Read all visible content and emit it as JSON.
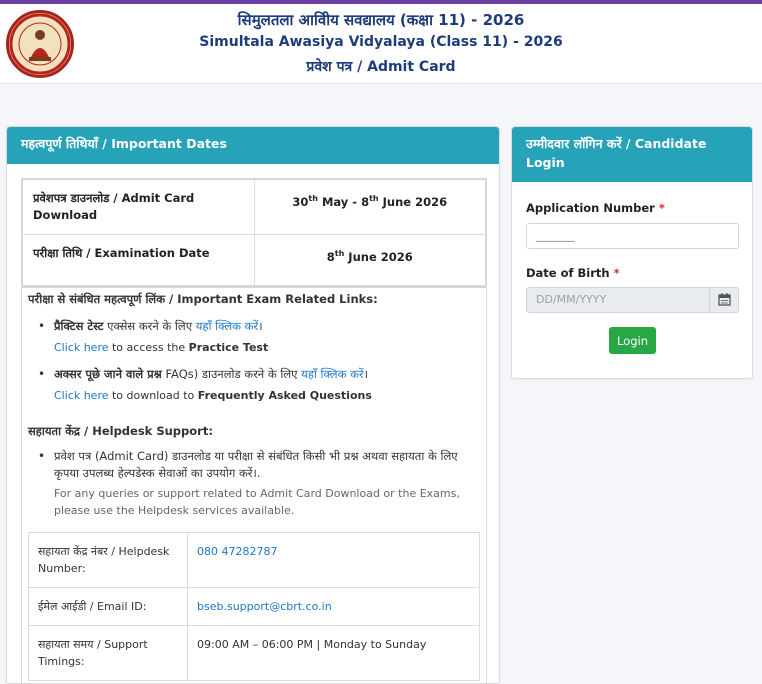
{
  "header": {
    "title_hi": "सिमुलतला आविीय सवद्यालय (कक्षा 11) - 2026",
    "title_en": "Simultala Awasiya Vidyalaya (Class 11) - 2026",
    "subtitle": "प्रवेश पत्र / Admit Card",
    "logo_icon": "bihar-board-emblem"
  },
  "dates_card": {
    "title": "महत्वपूर्ण तिथियाँ / Important Dates",
    "rows": [
      {
        "label": "प्रवेशपत्र डाउनलोड / Admit Card Download",
        "d1": "30",
        "s1": "th",
        "m1": " May - 8",
        "s2": "th",
        "m2": " June 2026"
      },
      {
        "label": "परीक्षा तिथि / Examination Date",
        "d1": "8",
        "s1": "th",
        "m1": " June 2026"
      }
    ],
    "links_title": "परीक्षा से संबंधित महत्वपूर्ण लिंक / Important Exam Related Links:",
    "links": [
      {
        "hi_bold": "प्रैक्टिस टेस्ट",
        "hi_text": " एक्सेस करने के लिए ",
        "hi_link": "यहाँ क्लिक करें",
        "hi_end": "।",
        "en_link": "Click here",
        "en_text": " to access the ",
        "en_bold": "Practice Test"
      },
      {
        "hi_bold": "अक्सर पूछे जाने वाले प्रश्न",
        "hi_text": " FAQs) डाउनलोड करने के लिए ",
        "hi_link": "यहाँ क्लिक करें",
        "hi_end": "।",
        "en_link": "Click here",
        "en_text": " to download to ",
        "en_bold": "Frequently Asked Questions"
      }
    ],
    "helpdesk_title": "सहायता केंद्र / Helpdesk Support:",
    "helpdesk_hi": "प्रवेश पत्र (Admit Card) डाउनलोड या परीक्षा से संबंधित किसी भी प्रश्न अथवा सहायता के लिए कृपया उपलब्ध हेल्पडेस्क सेवाओं का उपयोग करें।.",
    "helpdesk_en": "For any queries or support related to Admit Card Download or the Exams, please use the Helpdesk services available.",
    "help_rows": [
      {
        "label": "सहायता केंद्र नंबर / Helpdesk Number:",
        "value": "080 47282787"
      },
      {
        "label": "ईमेल आईडी / Email ID:",
        "value": "bseb.support@cbrt.co.in"
      },
      {
        "label": "सहायता समय / Support Timings:",
        "value": "09:00 AM – 06:00 PM | Monday to Sunday"
      }
    ]
  },
  "login_card": {
    "title": "उम्मीदवार लॉगिन करें / Candidate Login",
    "app_label": "Application Number",
    "app_value": "_______",
    "dob_label": "Date of Birth",
    "required_mark": "*",
    "dob_placeholder": "DD/MM/YYYY",
    "calendar_icon": "calendar-icon",
    "login_button": "Login"
  },
  "colors": {
    "accent": "#26a3b8",
    "top_bar": "#6a3fa0",
    "title": "#1f3c7a",
    "button": "#28a745",
    "link": "#1a77c9"
  }
}
